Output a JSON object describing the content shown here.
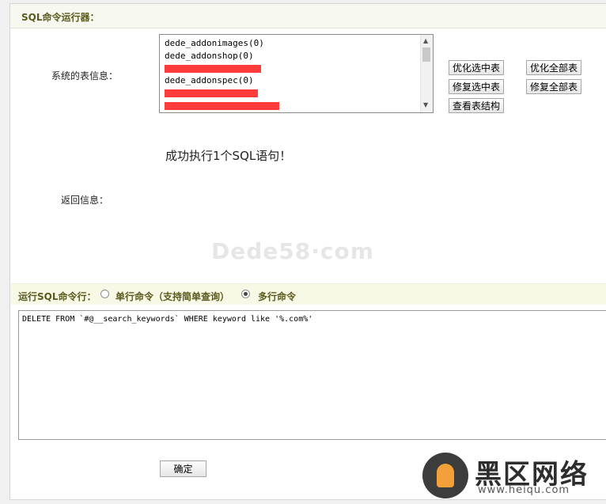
{
  "header": {
    "title": "SQL命令运行器："
  },
  "tables": {
    "label": "系统的表信息：",
    "items": [
      {
        "text": "dede_addonimages(0)",
        "redacted": false
      },
      {
        "text": "dede_addonshop(0)",
        "redacted": false
      },
      {
        "text": "",
        "redacted": true
      },
      {
        "text": "dede_addonspec(0)",
        "redacted": false
      },
      {
        "text": "",
        "redacted": true
      },
      {
        "text": "",
        "redacted": true
      }
    ]
  },
  "buttons": {
    "optimize_selected": "优化选中表",
    "optimize_all": "优化全部表",
    "repair_selected": "修复选中表",
    "repair_all": "修复全部表",
    "view_structure": "查看表结构",
    "confirm": "确定"
  },
  "result": {
    "message": "成功执行1个SQL语句！",
    "label": "返回信息："
  },
  "watermark": "Dede58·com",
  "command": {
    "label": "运行SQL命令行：",
    "single_label": "单行命令（支持简单查询）",
    "multi_label": "多行命令",
    "selected": "multi",
    "text": "DELETE FROM `#@__search_keywords` WHERE keyword like '%.com%'"
  },
  "site_logo": {
    "name": "黑区网络",
    "url": "www.heiqu.com"
  },
  "colors": {
    "header_bg": "#f7f9f1",
    "cmd_bar_bg": "#f7f9e6",
    "redaction": "#ff3b3b",
    "title_text": "#5a5a1e"
  }
}
